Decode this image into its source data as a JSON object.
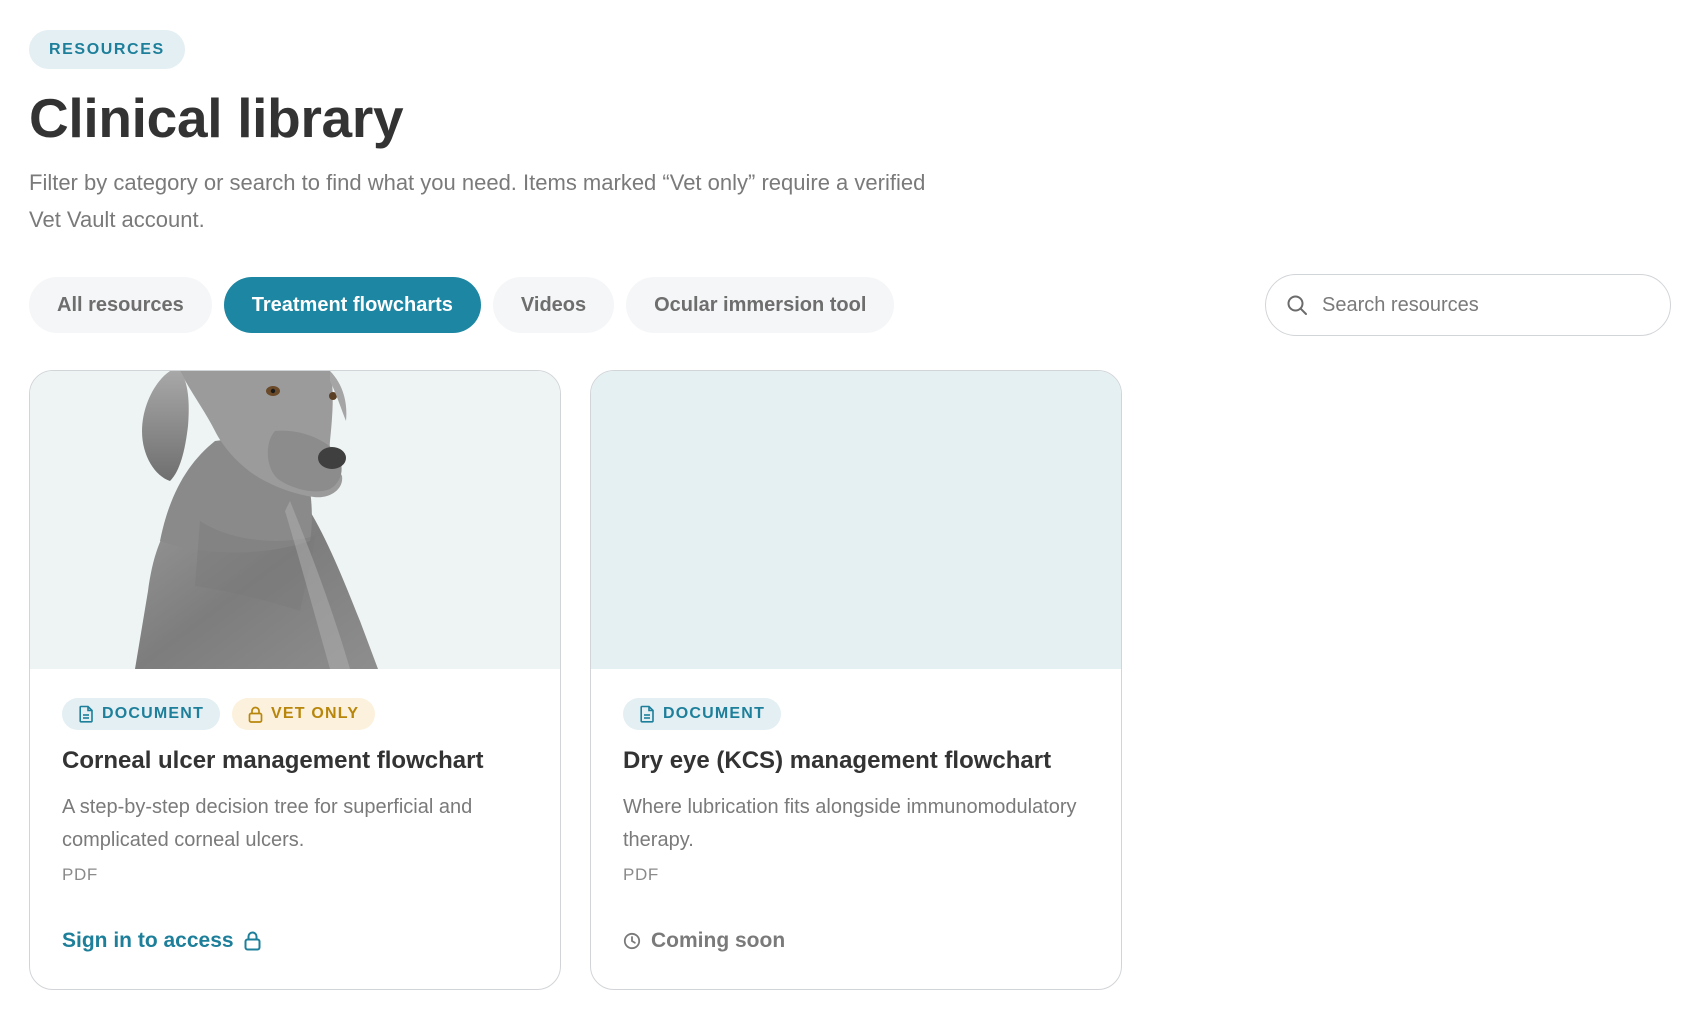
{
  "header": {
    "eyebrow": "RESOURCES",
    "title": "Clinical library",
    "intro": "Filter by category or search to find what you need. Items marked “Vet only” require a verified Vet Vault account."
  },
  "tabs": [
    {
      "label": "All resources",
      "active": false
    },
    {
      "label": "Treatment flowcharts",
      "active": true
    },
    {
      "label": "Videos",
      "active": false
    },
    {
      "label": "Ocular immersion tool",
      "active": false
    }
  ],
  "search": {
    "placeholder": "Search resources",
    "value": "",
    "icon": "search-icon"
  },
  "cards": [
    {
      "image": "grey weimaraner dog photo",
      "badges": [
        {
          "label": "DOCUMENT",
          "icon": "document-icon"
        },
        {
          "label": "VET ONLY",
          "icon": "lock-icon"
        }
      ],
      "title": "Corneal ulcer management flowchart",
      "description": "A step-by-step decision tree for superficial and complicated corneal ulcers.",
      "format": "PDF",
      "action": {
        "label": "Sign in to access",
        "icon": "lock-icon"
      }
    },
    {
      "image": "",
      "badges": [
        {
          "label": "DOCUMENT",
          "icon": "document-icon"
        }
      ],
      "title": "Dry eye (KCS) management flowchart",
      "description": "Where lubrication fits alongside immunomodulatory therapy.",
      "format": "PDF",
      "action": {
        "label": "Coming soon",
        "icon": "clock-icon"
      }
    }
  ],
  "colors": {
    "accent": "#1d86a3",
    "accent_text": "#1d7f9a",
    "vet_only_text": "#b8860b",
    "vet_only_bg": "#fcf1dc",
    "badge_bg": "#e3eff3"
  }
}
